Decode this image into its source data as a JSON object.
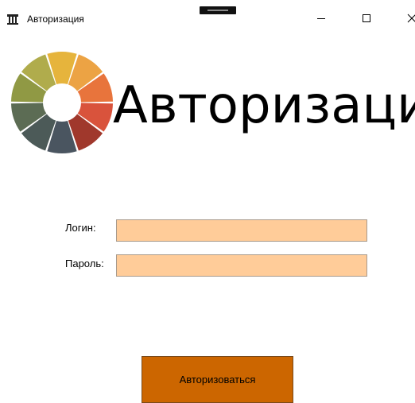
{
  "window": {
    "title": "Авторизация",
    "controls": {
      "minimize_icon": "minimize-icon",
      "maximize_icon": "maximize-icon",
      "close_icon": "close-icon"
    }
  },
  "header": {
    "title": "Авторизация",
    "logo_colors": [
      "#e6b43c",
      "#eca344",
      "#e8743c",
      "#d9533c",
      "#a0382c",
      "#4a5560",
      "#4c5a58",
      "#5c6c54",
      "#909944",
      "#b0ac4c"
    ]
  },
  "form": {
    "login_label": "Логин:",
    "login_value": "",
    "password_label": "Пароль:",
    "password_value": "",
    "field_color": "#ffcc99",
    "submit_label": "Авторизоваться",
    "submit_color": "#cc6600"
  }
}
